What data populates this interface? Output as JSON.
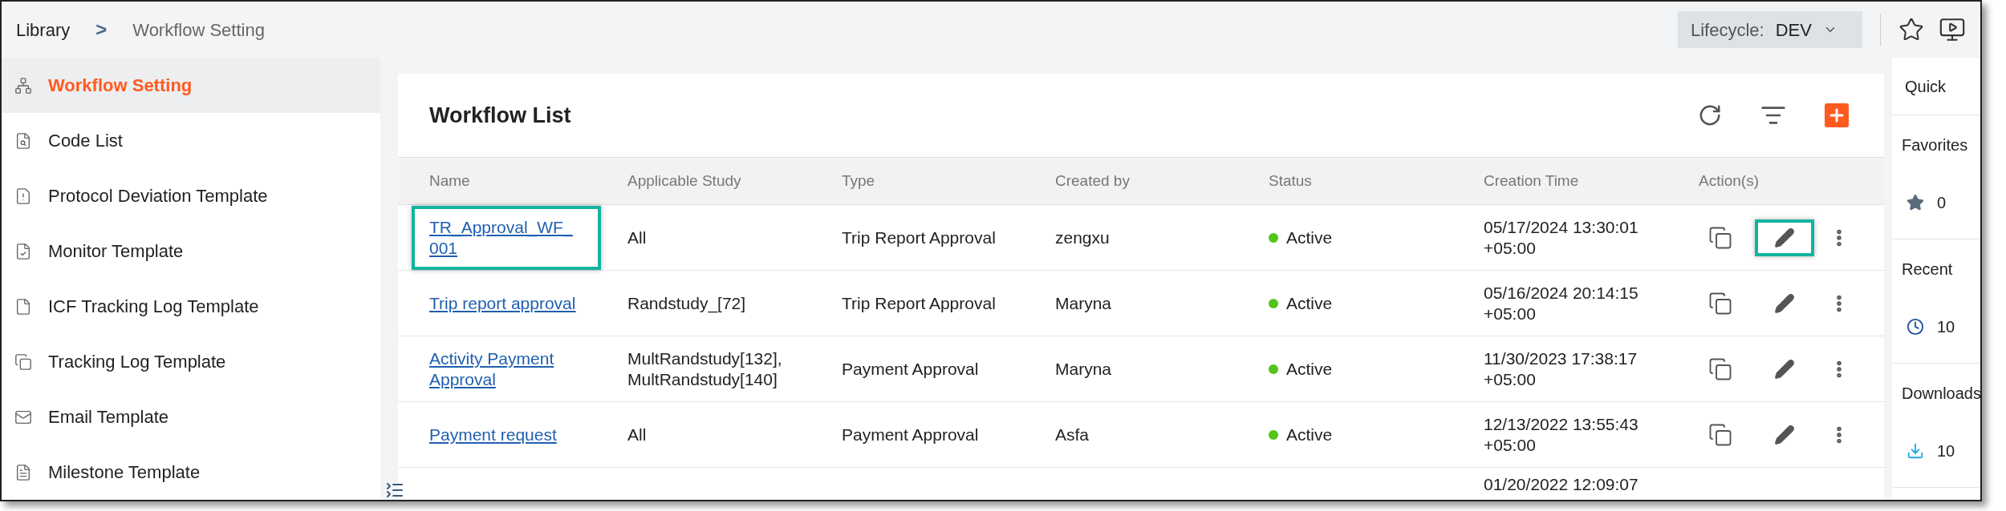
{
  "breadcrumb": {
    "items": [
      "Library",
      "Workflow Setting"
    ],
    "separator": ">"
  },
  "lifecycle": {
    "label": "Lifecycle:",
    "value": "DEV"
  },
  "sidebar": {
    "items": [
      {
        "label": "Workflow Setting",
        "selected": true
      },
      {
        "label": "Code List",
        "selected": false
      },
      {
        "label": "Protocol Deviation Template",
        "selected": false
      },
      {
        "label": "Monitor Template",
        "selected": false
      },
      {
        "label": "ICF Tracking Log Template",
        "selected": false
      },
      {
        "label": "Tracking Log Template",
        "selected": false
      },
      {
        "label": "Email Template",
        "selected": false
      },
      {
        "label": "Milestone Template",
        "selected": false
      }
    ]
  },
  "workflow_list": {
    "title": "Workflow List",
    "columns": [
      "Name",
      "Applicable Study",
      "Type",
      "Created by",
      "Status",
      "Creation Time",
      "Action(s)"
    ],
    "rows": [
      {
        "name": "TR_Approval_WF_001",
        "name_highlighted": true,
        "study": "All",
        "type": "Trip Report Approval",
        "created_by": "zengxu",
        "status": {
          "text": "Active",
          "color": "#52c41a"
        },
        "time": "05/17/2024 13:30:01 +05:00",
        "edit_highlighted": true
      },
      {
        "name": "Trip report approval",
        "name_highlighted": false,
        "study": "Randstudy_[72]",
        "type": "Trip Report Approval",
        "created_by": "Maryna",
        "status": {
          "text": "Active",
          "color": "#52c41a"
        },
        "time": "05/16/2024 20:14:15 +05:00",
        "edit_highlighted": false
      },
      {
        "name": "Activity Payment Approval",
        "name_highlighted": false,
        "study": "MultRandstudy[132], MultRandstudy[140]",
        "type": "Payment Approval",
        "created_by": "Maryna",
        "status": {
          "text": "Active",
          "color": "#52c41a"
        },
        "time": "11/30/2023 17:38:17 +05:00",
        "edit_highlighted": false
      },
      {
        "name": "Payment request",
        "name_highlighted": false,
        "study": "All",
        "type": "Payment Approval",
        "created_by": "Asfa",
        "status": {
          "text": "Active",
          "color": "#52c41a"
        },
        "time": "12/13/2022 13:55:43 +05:00",
        "edit_highlighted": false
      },
      {
        "time": "01/20/2022 12:09:07"
      }
    ]
  },
  "quick_panel": {
    "title": "Quick",
    "sections": [
      {
        "label": "Favorites",
        "count": "0"
      },
      {
        "label": "Recent",
        "count": "10"
      },
      {
        "label": "Downloads",
        "count": "10"
      }
    ]
  }
}
